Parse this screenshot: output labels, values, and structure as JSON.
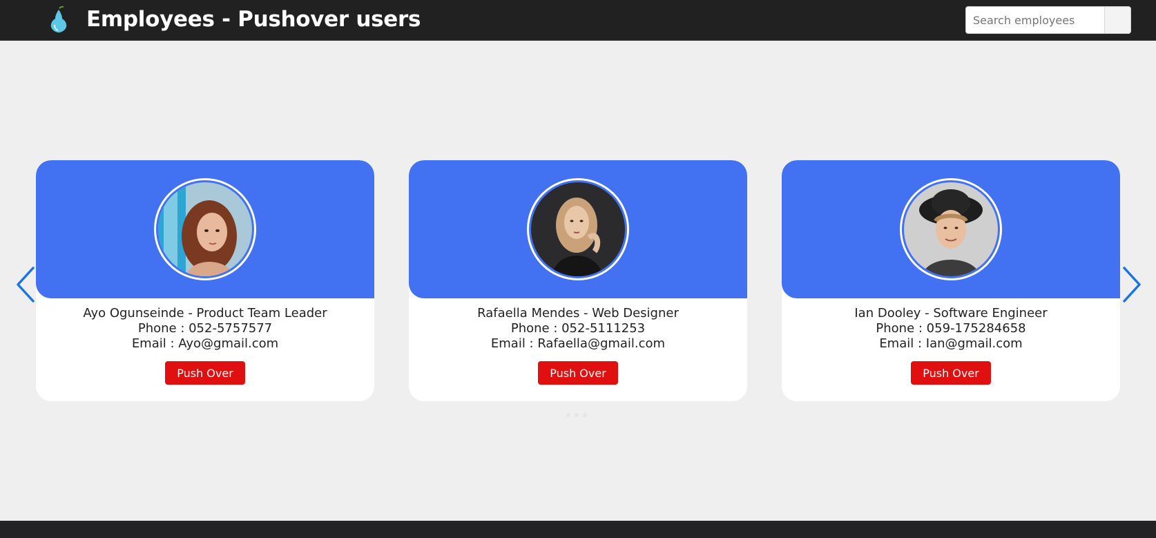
{
  "header": {
    "title": "Employees - Pushover users",
    "logo_icon": "pear-icon",
    "search": {
      "placeholder": "Search employees",
      "value": ""
    }
  },
  "colors": {
    "topbar": "#212121",
    "card_header": "#4271f1",
    "push_button": "#e01010",
    "arrow": "#1a73e8",
    "background": "#efefef"
  },
  "carousel": {
    "prev_icon": "chevron-left-icon",
    "next_icon": "chevron-right-icon",
    "cards": [
      {
        "name_role": "Ayo Ogunseinde - Product Team Leader",
        "phone": "Phone : 052-5757577",
        "email": "Email : Ayo@gmail.com",
        "button": "Push Over"
      },
      {
        "name_role": "Rafaella Mendes - Web Designer",
        "phone": "Phone : 052-5111253",
        "email": "Email : Rafaella@gmail.com",
        "button": "Push Over"
      },
      {
        "name_role": "Ian Dooley - Software Engineer",
        "phone": "Phone : 059-175284658",
        "email": "Email : Ian@gmail.com",
        "button": "Push Over"
      }
    ]
  }
}
